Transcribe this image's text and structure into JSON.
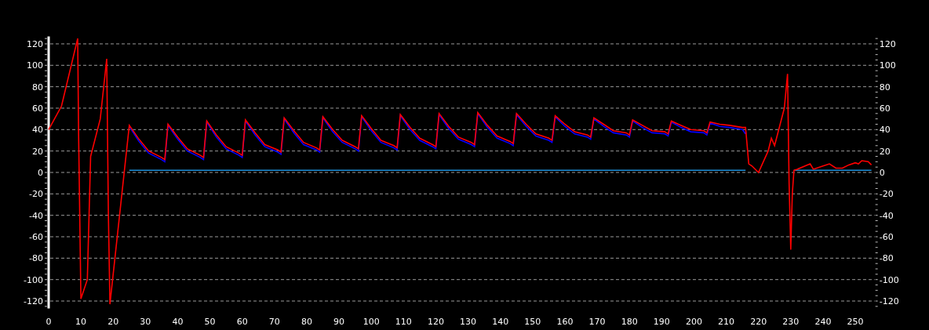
{
  "chart": {
    "chart_data": {
      "type": "line",
      "x": [
        0,
        4,
        9,
        9.3,
        10,
        12,
        13,
        16,
        18,
        18.5,
        19,
        25,
        28,
        31,
        35,
        36,
        37,
        40,
        43,
        47,
        48,
        49,
        52,
        55,
        59,
        60,
        61,
        64,
        67,
        71,
        72,
        73,
        76,
        79,
        83,
        84,
        85,
        88,
        91,
        95,
        96,
        97,
        100,
        103,
        107,
        108,
        109,
        112,
        115,
        119,
        120,
        121,
        124,
        127,
        131,
        132,
        133,
        136,
        139,
        143,
        144,
        145,
        148,
        151,
        155,
        156,
        157,
        160,
        163,
        167,
        168,
        169,
        172,
        175,
        179,
        180,
        181,
        184,
        187,
        191,
        192,
        193,
        196,
        199,
        203,
        204,
        205,
        208,
        211,
        215,
        216,
        217,
        218,
        220,
        223,
        224,
        225,
        228,
        229,
        229.5,
        230,
        230.5,
        231,
        232,
        236,
        237,
        240,
        242,
        244,
        246,
        248,
        250,
        251,
        252,
        254,
        255
      ],
      "series": [
        {
          "color": "#1e8fd8",
          "values": [
            null,
            null,
            null,
            null,
            null,
            null,
            null,
            null,
            null,
            null,
            null,
            2,
            2,
            2,
            2,
            2,
            2,
            2,
            2,
            2,
            2,
            2,
            2,
            2,
            2,
            2,
            2,
            2,
            2,
            2,
            2,
            2,
            2,
            2,
            2,
            2,
            2,
            2,
            2,
            2,
            2,
            2,
            2,
            2,
            2,
            2,
            2,
            2,
            2,
            2,
            2,
            2,
            2,
            2,
            2,
            2,
            2,
            2,
            2,
            2,
            2,
            2,
            2,
            2,
            2,
            2,
            2,
            2,
            2,
            2,
            2,
            2,
            2,
            2,
            2,
            2,
            2,
            2,
            2,
            2,
            2,
            2,
            2,
            2,
            2,
            2,
            2,
            2,
            2,
            2,
            2,
            null,
            null,
            null,
            null,
            null,
            null,
            null,
            null,
            null,
            null,
            null,
            2,
            2,
            2,
            2,
            2,
            2,
            2,
            2,
            2,
            2,
            2,
            2,
            2,
            2
          ]
        },
        {
          "color": "#0000ff",
          "values": [
            null,
            null,
            null,
            null,
            null,
            null,
            null,
            null,
            null,
            null,
            null,
            43,
            29,
            18,
            12,
            10,
            44,
            31,
            20,
            14,
            12,
            47,
            33,
            22,
            16,
            14,
            48,
            35,
            24,
            19,
            17,
            50,
            37,
            26,
            21,
            19,
            51,
            38,
            28,
            22,
            20,
            52,
            39,
            28,
            23,
            21,
            53,
            40,
            30,
            24,
            22,
            54,
            41,
            31,
            26,
            24,
            55,
            42,
            32,
            27,
            25,
            54,
            43,
            34,
            30,
            28,
            52,
            43,
            36,
            33,
            31,
            50,
            43,
            37,
            35,
            33,
            48,
            42,
            37,
            36,
            34,
            47,
            42,
            38,
            37,
            35,
            46,
            43,
            42,
            40,
            36,
            null,
            null,
            null,
            null,
            null,
            null,
            null,
            null,
            null,
            null,
            null,
            null,
            null,
            null,
            null,
            null,
            null,
            null,
            null,
            null,
            null,
            null,
            null,
            null,
            null
          ]
        },
        {
          "color": "#ff0000",
          "values": [
            40,
            62,
            125,
            35,
            -118,
            -100,
            15,
            50,
            106,
            -37,
            -123,
            44,
            31,
            20,
            14,
            12,
            45,
            33,
            22,
            16,
            14,
            48,
            35,
            24,
            18,
            16,
            49,
            37,
            26,
            21,
            19,
            51,
            39,
            28,
            23,
            21,
            52,
            40,
            30,
            24,
            22,
            53,
            41,
            30,
            25,
            23,
            54,
            42,
            32,
            26,
            24,
            55,
            43,
            33,
            28,
            26,
            56,
            44,
            34,
            29,
            27,
            55,
            45,
            36,
            32,
            30,
            53,
            45,
            38,
            35,
            33,
            51,
            45,
            39,
            37,
            35,
            49,
            44,
            39,
            38,
            36,
            48,
            44,
            40,
            39,
            37,
            47,
            45,
            44,
            42,
            42,
            8,
            6,
            0,
            20,
            32,
            25,
            60,
            92,
            -10,
            -72,
            -20,
            2,
            3,
            8,
            3,
            6,
            8,
            4,
            4,
            7,
            9,
            8,
            11,
            10,
            7
          ]
        }
      ],
      "xlim": [
        0,
        256
      ],
      "ylim": [
        -127,
        127
      ],
      "xticks": [
        0,
        10,
        20,
        30,
        40,
        50,
        60,
        70,
        80,
        90,
        100,
        110,
        120,
        130,
        140,
        150,
        160,
        170,
        180,
        190,
        200,
        210,
        220,
        230,
        240,
        250
      ],
      "yticks": [
        -120,
        -100,
        -80,
        -60,
        -40,
        -20,
        0,
        20,
        40,
        60,
        80,
        100,
        120
      ],
      "y2ticks": [
        -120,
        -100,
        -80,
        -60,
        -40,
        -20,
        0,
        20,
        40,
        60,
        80,
        100,
        120
      ],
      "y2lim": [
        -127,
        127
      ],
      "grid": true
    }
  }
}
